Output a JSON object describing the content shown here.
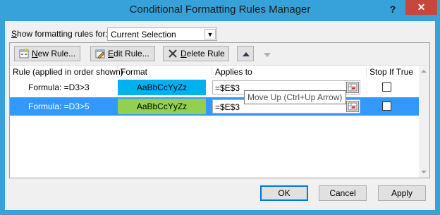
{
  "window": {
    "title": "Conditional Formatting Rules Manager",
    "help_label": "?",
    "close_label": "✕"
  },
  "show_rules": {
    "label_prefix": "",
    "label_accel": "S",
    "label_rest": "how formatting rules for:",
    "selected": "Current Selection"
  },
  "toolbar": {
    "new_rule_accel": "N",
    "new_rule_rest": "ew Rule...",
    "edit_rule_accel": "E",
    "edit_rule_rest": "dit Rule...",
    "delete_rule_accel": "D",
    "delete_rule_rest": "elete Rule"
  },
  "columns": [
    "Rule (applied in order shown)",
    "Format",
    "Applies to",
    "Stop If True"
  ],
  "rules": [
    {
      "rule": "Formula: =D3>3",
      "preview": "AaBbCcYyZz",
      "preview_bg": "#00b0f0",
      "applies_to": "=$E$3",
      "stop_if_true": false,
      "selected": false
    },
    {
      "rule": "Formula: =D3>5",
      "preview": "AaBbCcYyZz",
      "preview_bg": "#92d050",
      "applies_to": "=$E$3",
      "stop_if_true": false,
      "selected": true
    }
  ],
  "tooltip": "Move Up (Ctrl+Up Arrow)",
  "buttons": {
    "ok": "OK",
    "cancel": "Cancel",
    "apply": "Apply"
  },
  "colors": {
    "selection": "#3399ff",
    "title_bar": "#37a2d9",
    "close": "#c7473a"
  }
}
